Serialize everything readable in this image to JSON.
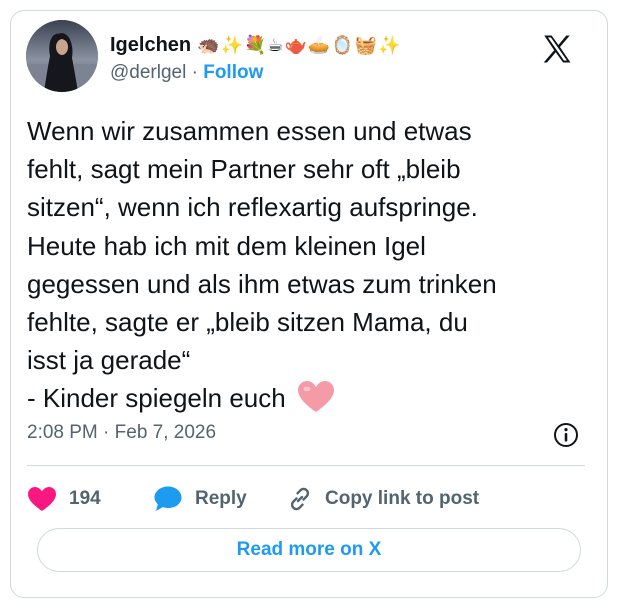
{
  "author": {
    "display_name": "Igelchen",
    "name_emojis": "🦔✨💐☕🫖🥧🪞🧺✨",
    "handle": "@derlgel",
    "separator": "·",
    "follow_label": "Follow",
    "avatar_icon": "user-avatar-photo"
  },
  "brand": {
    "logo_icon": "x-logo-icon",
    "accent_color": "#1d9bf0"
  },
  "tweet": {
    "text": "Wenn wir zusammen essen und etwas\nfehlt, sagt mein Partner sehr oft „bleib\nsitzen“, wenn ich reflexartig aufspringe.\nHeute hab ich mit dem kleinen Igel\ngegessen und als ihm etwas zum trinken\nfehlte, sagte er „bleib sitzen Mama, du\nisst ja gerade“\n- Kinder spiegeln euch ",
    "trailing_emoji_icon": "pink-heart-icon",
    "timestamp": "2:08 PM · Feb 7, 2026"
  },
  "actions": {
    "like_count": "194",
    "like_color": "#f91880",
    "reply_label": "Reply",
    "copy_link_label": "Copy link to post"
  },
  "read_more_label": "Read more on X"
}
